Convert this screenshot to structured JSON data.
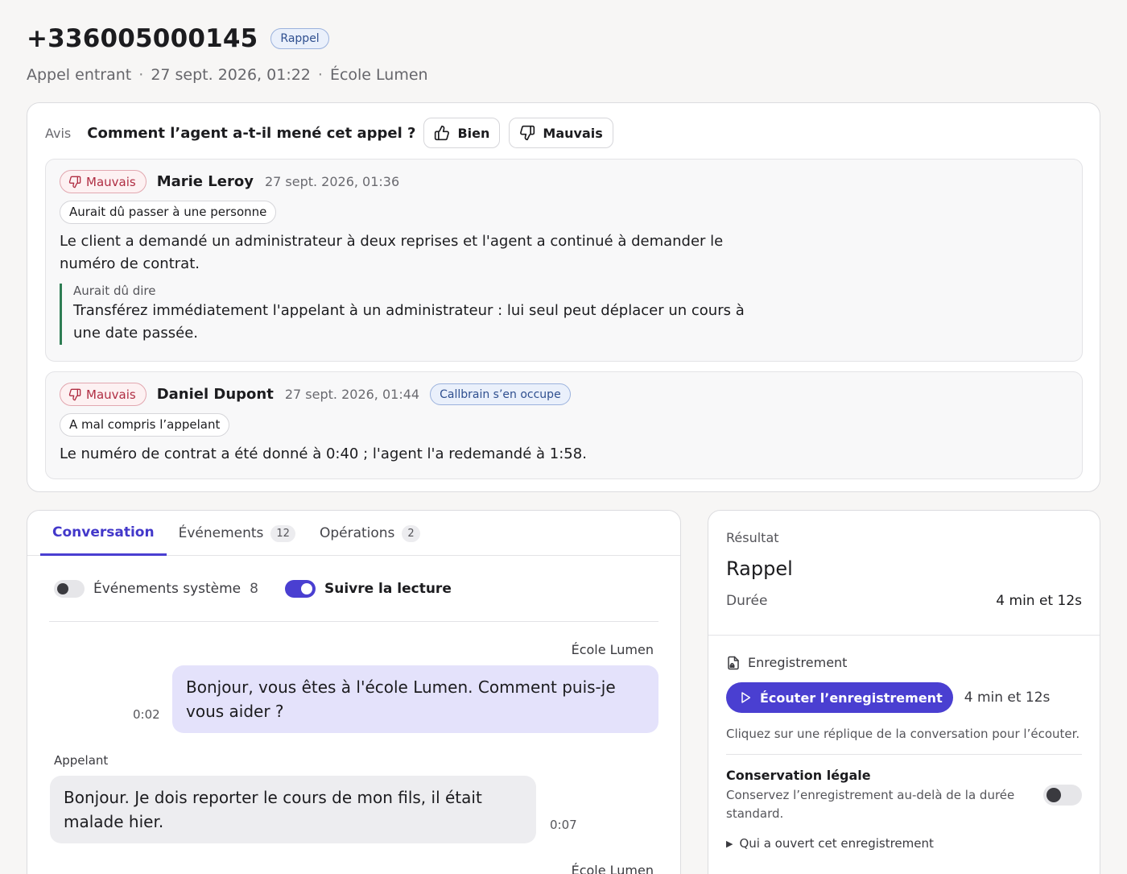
{
  "header": {
    "phone": "+336005000145",
    "badge": "Rappel",
    "direction": "Appel entrant",
    "datetime": "27 sept. 2026, 01:22",
    "organization": "École Lumen",
    "separator": "·"
  },
  "feedback": {
    "label": "Avis",
    "question": "Comment l’agent a-t-il mené cet appel ?",
    "good_label": "Bien",
    "bad_label": "Mauvais",
    "entries": [
      {
        "verdict": "Mauvais",
        "author": "Marie Leroy",
        "date": "27 sept. 2026, 01:36",
        "tag": "Aurait dû passer à une personne",
        "text": "Le client a demandé un administrateur à deux reprises et l'agent a continué à demander le numéro de contrat.",
        "quote_label": "Aurait dû dire",
        "quote_text": "Transférez immédiatement l'appelant à un administrateur : lui seul peut déplacer un cours à une date passée."
      },
      {
        "verdict": "Mauvais",
        "author": "Daniel Dupont",
        "date": "27 sept. 2026, 01:44",
        "status": "Callbrain s’en occupe",
        "tag": "A mal compris l’appelant",
        "text": "Le numéro de contrat a été donné à 0:40 ; l'agent l'a redemandé à 1:58."
      }
    ]
  },
  "tabs": [
    {
      "label": "Conversation",
      "count": ""
    },
    {
      "label": "Événements",
      "count": "12"
    },
    {
      "label": "Opérations",
      "count": "2"
    }
  ],
  "toggles": {
    "system_events_label": "Événements système",
    "system_events_count": "8",
    "system_events_on": false,
    "follow_label": "Suivre la lecture",
    "follow_on": true
  },
  "conversation": [
    {
      "speaker": "École Lumen",
      "text": "Bonjour, vous êtes à l'école Lumen. Comment puis-je vous aider ?",
      "time": "0:02"
    },
    {
      "speaker": "Appelant",
      "text": "Bonjour. Je dois reporter le cours de mon fils, il était malade hier.",
      "time": "0:07"
    },
    {
      "speaker": "École Lumen",
      "text": "",
      "time": ""
    }
  ],
  "result": {
    "label": "Résultat",
    "value": "Rappel",
    "duration_label": "Durée",
    "duration_value": "4 min et 12s"
  },
  "recording": {
    "title": "Enregistrement",
    "play_label": "Écouter l’enregistrement",
    "duration": "4 min et 12s",
    "hint": "Cliquez sur une réplique de la conversation pour l’écouter.",
    "legal_title": "Conservation légale",
    "legal_desc": "Conservez l’enregistrement au-delà de la durée standard.",
    "legal_on": false,
    "who_opened": "Qui a ouvert cet enregistrement"
  },
  "colors": {
    "accent": "#4a3fd1",
    "bad": "#b02e43",
    "agent_bubble": "#e4e2fb",
    "caller_bubble": "#ededf0"
  }
}
